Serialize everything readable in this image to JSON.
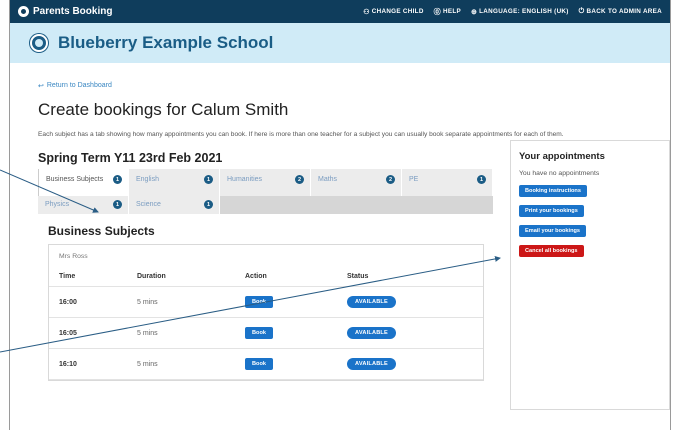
{
  "topbar": {
    "brand": "Parents Booking",
    "links": [
      {
        "icon": "people-icon",
        "glyph": "⚇",
        "label": "CHANGE CHILD"
      },
      {
        "icon": "help-icon",
        "glyph": "⓪",
        "label": "HELP"
      },
      {
        "icon": "globe-icon",
        "glyph": "⊕",
        "label": "LANGUAGE: ENGLISH (UK)"
      },
      {
        "icon": "power-icon",
        "glyph": "⏻",
        "label": "BACK TO ADMIN AREA"
      }
    ]
  },
  "school": {
    "name": "Blueberry Example School"
  },
  "page": {
    "return_link": "Return to Dashboard",
    "return_arrow": "↩",
    "title": "Create bookings for Calum Smith",
    "intro": "Each subject has a tab showing how many appointments you can book. If here is more than one teacher for a subject you can usually book separate appointments for each of them.",
    "term_title": "Spring Term Y11 23rd Feb 2021"
  },
  "tabs": {
    "row1": [
      {
        "label": "Business Subjects",
        "count": "1",
        "active": true
      },
      {
        "label": "English",
        "count": "1"
      },
      {
        "label": "Humanities",
        "count": "2"
      },
      {
        "label": "Maths",
        "count": "2"
      },
      {
        "label": "PE",
        "count": "1"
      }
    ],
    "row2": [
      {
        "label": "Physics",
        "count": "1"
      },
      {
        "label": "Science",
        "count": "1"
      }
    ]
  },
  "section": {
    "title": "Business Subjects",
    "teacher": "Mrs Ross",
    "columns": {
      "time": "Time",
      "duration": "Duration",
      "action": "Action",
      "status": "Status"
    },
    "rows": [
      {
        "time": "16:00",
        "duration": "5 mins",
        "action": "Book",
        "status": "AVAILABLE"
      },
      {
        "time": "16:05",
        "duration": "5 mins",
        "action": "Book",
        "status": "AVAILABLE"
      },
      {
        "time": "16:10",
        "duration": "5 mins",
        "action": "Book",
        "status": "AVAILABLE"
      }
    ]
  },
  "sidebar": {
    "title": "Your appointments",
    "note": "You have no appointments",
    "buttons": {
      "instructions": "Booking instructions",
      "print": "Print your bookings",
      "email": "Email your bookings",
      "cancel": "Cancel all bookings"
    }
  },
  "colors": {
    "topbar": "#0f3d5c",
    "school_band": "#d0ebf7",
    "accent": "#1a73c9",
    "danger": "#cc1717",
    "arrow": "#2a5d85"
  }
}
